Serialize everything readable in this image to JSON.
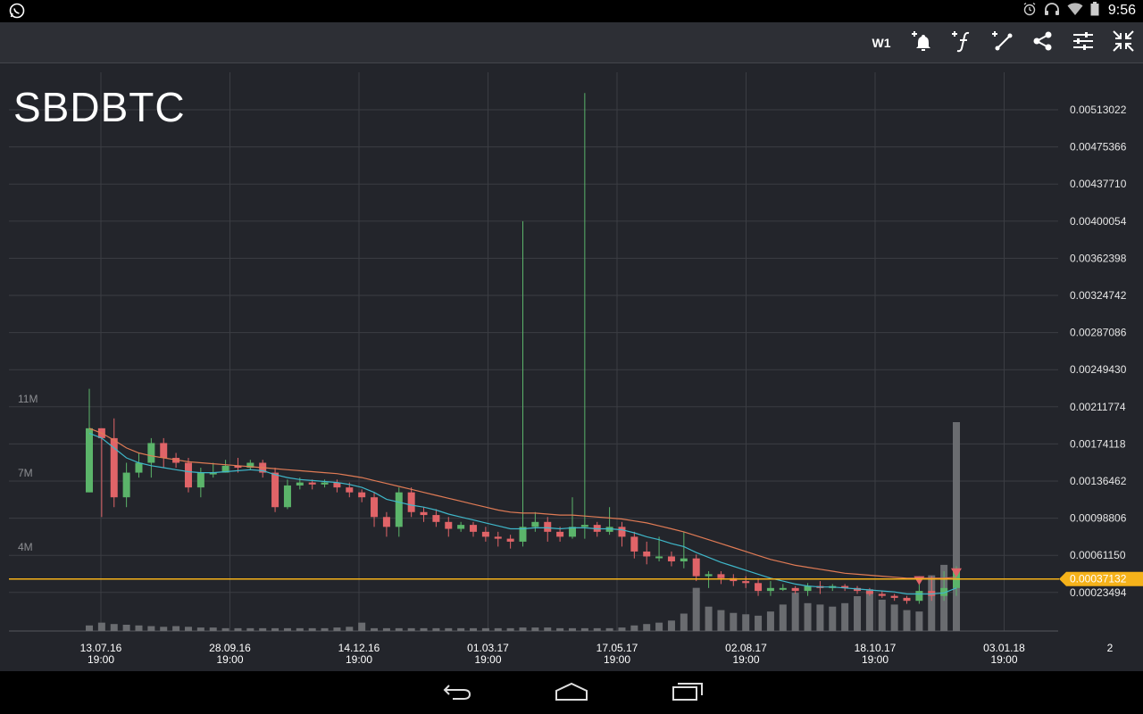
{
  "status_bar": {
    "time": "9:56",
    "icons": [
      "whatsapp-icon",
      "alarm-icon",
      "headphones-icon",
      "wifi-icon",
      "battery-icon"
    ]
  },
  "toolbar": {
    "timeframe_label": "W1",
    "buttons": [
      "add-alert-icon",
      "add-indicator-icon",
      "add-drawing-icon",
      "share-icon",
      "settings-icon",
      "collapse-icon"
    ]
  },
  "symbol": "SBDBTC",
  "colors": {
    "background": "#23252b",
    "grid": "#3b3d43",
    "up": "#5bb46a",
    "down": "#e06468",
    "ma_fast": "#3fb7c9",
    "ma_slow": "#e07b55",
    "price_line": "#f5b21a",
    "volume": "#6a6c70"
  },
  "chart_data": {
    "type": "candlestick",
    "y_ticks": [
      "0.00513022",
      "0.00475366",
      "0.00437710",
      "0.00400054",
      "0.00362398",
      "0.00324742",
      "0.00287086",
      "0.00249430",
      "0.00211774",
      "0.00174118",
      "0.00136462",
      "0.00098806",
      "0.00061150",
      "0.00023494"
    ],
    "x_ticks": [
      {
        "date": "13.07.16",
        "time": "19:00"
      },
      {
        "date": "28.09.16",
        "time": "19:00"
      },
      {
        "date": "14.12.16",
        "time": "19:00"
      },
      {
        "date": "01.03.17",
        "time": "19:00"
      },
      {
        "date": "17.05.17",
        "time": "19:00"
      },
      {
        "date": "02.08.17",
        "time": "19:00"
      },
      {
        "date": "18.10.17",
        "time": "19:00"
      },
      {
        "date": "03.01.18",
        "time": "19:00"
      },
      {
        "date": "2",
        "time": ""
      }
    ],
    "volume_ticks": [
      "11M",
      "7M",
      "4M"
    ],
    "current_price": "0.00037132",
    "candles": [
      [
        0.00125,
        0.0019,
        0.0023,
        0.00125
      ],
      [
        0.0019,
        0.0018,
        0.0019,
        0.001
      ],
      [
        0.0018,
        0.0012,
        0.002,
        0.0011
      ],
      [
        0.0012,
        0.00145,
        0.00155,
        0.0011
      ],
      [
        0.00145,
        0.00155,
        0.00165,
        0.0014
      ],
      [
        0.00155,
        0.00175,
        0.0018,
        0.0014
      ],
      [
        0.00175,
        0.0016,
        0.0018,
        0.0015
      ],
      [
        0.0016,
        0.00155,
        0.00165,
        0.0015
      ],
      [
        0.00155,
        0.0013,
        0.0016,
        0.00125
      ],
      [
        0.0013,
        0.00145,
        0.0015,
        0.0012
      ],
      [
        0.00145,
        0.00145,
        0.00155,
        0.0014
      ],
      [
        0.00145,
        0.00152,
        0.00158,
        0.00145
      ],
      [
        0.00152,
        0.0015,
        0.0016,
        0.00145
      ],
      [
        0.0015,
        0.00155,
        0.00158,
        0.00148
      ],
      [
        0.00155,
        0.00145,
        0.00158,
        0.0014
      ],
      [
        0.00145,
        0.0011,
        0.0015,
        0.00105
      ],
      [
        0.0011,
        0.00132,
        0.00138,
        0.00108
      ],
      [
        0.00132,
        0.00135,
        0.0014,
        0.00128
      ],
      [
        0.00135,
        0.00133,
        0.00138,
        0.00128
      ],
      [
        0.00133,
        0.00135,
        0.00138,
        0.0013
      ],
      [
        0.00135,
        0.0013,
        0.00138,
        0.00125
      ],
      [
        0.0013,
        0.00125,
        0.00135,
        0.0012
      ],
      [
        0.00125,
        0.0012,
        0.00128,
        0.00115
      ],
      [
        0.0012,
        0.001,
        0.00125,
        0.0009
      ],
      [
        0.001,
        0.0009,
        0.00105,
        0.0008
      ],
      [
        0.0009,
        0.00125,
        0.0013,
        0.0008
      ],
      [
        0.00125,
        0.00105,
        0.0013,
        0.001
      ],
      [
        0.00105,
        0.00102,
        0.0011,
        0.00095
      ],
      [
        0.00102,
        0.00095,
        0.00108,
        0.0009
      ],
      [
        0.00095,
        0.00088,
        0.001,
        0.0008
      ],
      [
        0.00088,
        0.00092,
        0.00095,
        0.00085
      ],
      [
        0.00092,
        0.00085,
        0.00095,
        0.0008
      ],
      [
        0.00085,
        0.0008,
        0.0009,
        0.00075
      ],
      [
        0.0008,
        0.00078,
        0.00085,
        0.0007
      ],
      [
        0.00078,
        0.00075,
        0.00082,
        0.00068
      ],
      [
        0.00075,
        0.0009,
        0.004,
        0.0007
      ],
      [
        0.0009,
        0.00095,
        0.00105,
        0.00085
      ],
      [
        0.00095,
        0.00085,
        0.001,
        0.00075
      ],
      [
        0.00085,
        0.0008,
        0.0009,
        0.00075
      ],
      [
        0.0008,
        0.0009,
        0.0012,
        0.00078
      ],
      [
        0.0009,
        0.00092,
        0.0053,
        0.00078
      ],
      [
        0.00092,
        0.00085,
        0.00095,
        0.0008
      ],
      [
        0.00085,
        0.0009,
        0.0011,
        0.00082
      ],
      [
        0.0009,
        0.0008,
        0.00095,
        0.0007
      ],
      [
        0.0008,
        0.00065,
        0.00085,
        0.00058
      ],
      [
        0.00065,
        0.0006,
        0.00075,
        0.00052
      ],
      [
        0.0006,
        0.0006,
        0.0008,
        0.00055
      ],
      [
        0.0006,
        0.00055,
        0.00065,
        0.0005
      ],
      [
        0.00055,
        0.00058,
        0.00085,
        0.00048
      ],
      [
        0.00058,
        0.0004,
        0.00062,
        0.00035
      ],
      [
        0.0004,
        0.00042,
        0.00045,
        0.00028
      ],
      [
        0.00042,
        0.00038,
        0.00045,
        0.00032
      ],
      [
        0.00038,
        0.00035,
        0.00042,
        0.0003
      ],
      [
        0.00035,
        0.00033,
        0.0004,
        0.00028
      ],
      [
        0.00033,
        0.00025,
        0.00038,
        0.0002
      ],
      [
        0.00025,
        0.00028,
        0.00035,
        0.0002
      ],
      [
        0.00028,
        0.00028,
        0.00032,
        0.00025
      ],
      [
        0.00028,
        0.00025,
        0.0003,
        0.00022
      ],
      [
        0.00025,
        0.0003,
        0.00033,
        0.0002
      ],
      [
        0.0003,
        0.00028,
        0.00035,
        0.00022
      ],
      [
        0.00028,
        0.0003,
        0.00032,
        0.00025
      ],
      [
        0.0003,
        0.00028,
        0.00032,
        0.00025
      ],
      [
        0.00028,
        0.00025,
        0.0003,
        0.00022
      ],
      [
        0.00025,
        0.00022,
        0.00028,
        0.0002
      ],
      [
        0.00022,
        0.0002,
        0.00025,
        0.00018
      ],
      [
        0.0002,
        0.00018,
        0.00022,
        0.00015
      ],
      [
        0.00018,
        0.00015,
        0.0002,
        0.00012
      ],
      [
        0.00015,
        0.00025,
        0.0004,
        0.00012
      ],
      [
        0.00025,
        0.0002,
        0.0004,
        0.00015
      ],
      [
        0.0002,
        0.00028,
        0.00045,
        0.00015
      ],
      [
        0.00028,
        0.00045,
        0.0005,
        0.0002
      ]
    ],
    "volumes": [
      0.08,
      0.12,
      0.1,
      0.09,
      0.08,
      0.07,
      0.06,
      0.07,
      0.06,
      0.05,
      0.05,
      0.04,
      0.04,
      0.04,
      0.04,
      0.04,
      0.04,
      0.04,
      0.04,
      0.04,
      0.05,
      0.06,
      0.12,
      0.04,
      0.04,
      0.04,
      0.04,
      0.04,
      0.04,
      0.04,
      0.04,
      0.04,
      0.04,
      0.04,
      0.04,
      0.05,
      0.05,
      0.05,
      0.04,
      0.04,
      0.04,
      0.04,
      0.04,
      0.05,
      0.08,
      0.1,
      0.12,
      0.15,
      0.25,
      0.62,
      0.35,
      0.3,
      0.26,
      0.24,
      0.22,
      0.28,
      0.38,
      0.55,
      0.4,
      0.38,
      0.35,
      0.4,
      0.5,
      0.6,
      0.45,
      0.38,
      0.3,
      0.28,
      0.8,
      0.95,
      3.0,
      2.1,
      2.65,
      0.4
    ],
    "ma_fast": [
      0.00185,
      0.0018,
      0.0017,
      0.0016,
      0.00155,
      0.00152,
      0.0015,
      0.00148,
      0.00146,
      0.00145,
      0.00145,
      0.00146,
      0.00147,
      0.00148,
      0.00147,
      0.00143,
      0.0014,
      0.00138,
      0.00137,
      0.00136,
      0.00135,
      0.00133,
      0.0013,
      0.00125,
      0.00118,
      0.00115,
      0.00112,
      0.0011,
      0.00107,
      0.00103,
      0.001,
      0.00097,
      0.00094,
      0.00091,
      0.00088,
      0.00088,
      0.00089,
      0.00089,
      0.00088,
      0.00089,
      0.00089,
      0.00088,
      0.00088,
      0.00087,
      0.00084,
      0.0008,
      0.00077,
      0.00073,
      0.0007,
      0.00064,
      0.00059,
      0.00054,
      0.0005,
      0.00046,
      0.00042,
      0.00038,
      0.00035,
      0.00032,
      0.0003,
      0.00029,
      0.00029,
      0.00028,
      0.00027,
      0.00026,
      0.00025,
      0.00024,
      0.00022,
      0.00022,
      0.00022,
      0.00023,
      0.00028
    ],
    "ma_slow": [
      0.0019,
      0.00185,
      0.00178,
      0.0017,
      0.00165,
      0.00162,
      0.0016,
      0.00158,
      0.00156,
      0.00155,
      0.00154,
      0.00153,
      0.00152,
      0.00151,
      0.0015,
      0.00149,
      0.00148,
      0.00147,
      0.00146,
      0.00145,
      0.00144,
      0.00142,
      0.0014,
      0.00137,
      0.00134,
      0.00131,
      0.00128,
      0.00125,
      0.00122,
      0.00119,
      0.00116,
      0.00113,
      0.0011,
      0.00107,
      0.00105,
      0.00104,
      0.00104,
      0.00103,
      0.00102,
      0.00102,
      0.00101,
      0.001,
      0.00099,
      0.00098,
      0.00096,
      0.00094,
      0.00091,
      0.00088,
      0.00085,
      0.00081,
      0.00077,
      0.00073,
      0.00069,
      0.00065,
      0.00061,
      0.00057,
      0.00054,
      0.00051,
      0.00049,
      0.00047,
      0.00045,
      0.00043,
      0.00042,
      0.00041,
      0.0004,
      0.00039,
      0.00038,
      0.00038,
      0.00038,
      0.00038,
      0.00039
    ]
  }
}
